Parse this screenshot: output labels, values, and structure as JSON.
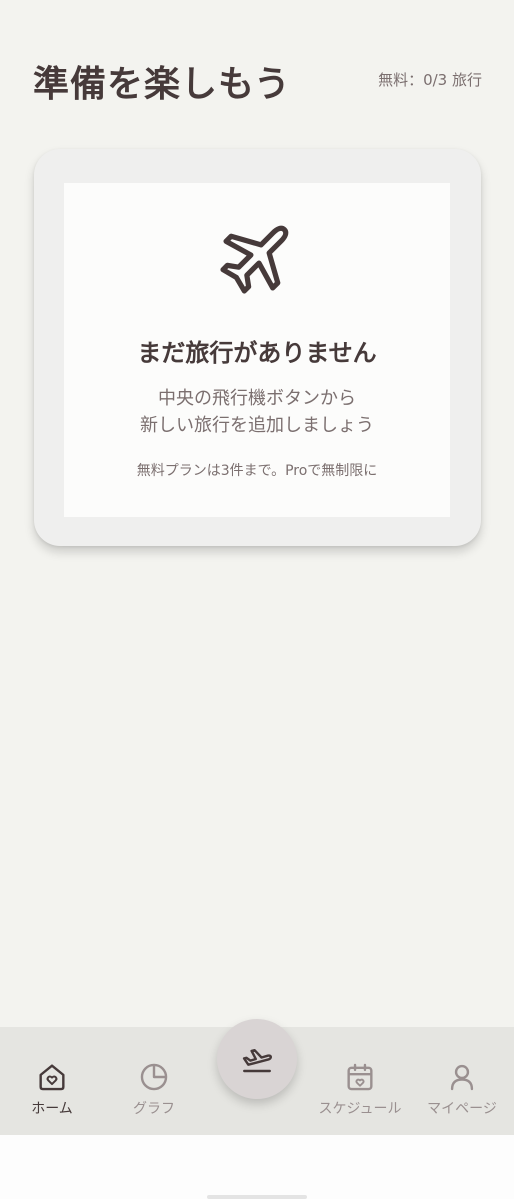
{
  "header": {
    "title": "準備を楽しもう",
    "quota": "無料：0/3 旅行"
  },
  "empty_state": {
    "icon": "airplane-icon",
    "title": "まだ旅行がありません",
    "description_line1": "中央の飛行機ボタンから",
    "description_line2": "新しい旅行を追加しましょう",
    "note": "無料プランは3件まで。Proで無制限に"
  },
  "tabs": [
    {
      "label": "ホーム",
      "icon": "home-heart-icon",
      "active": true
    },
    {
      "label": "グラフ",
      "icon": "pie-chart-icon",
      "active": false
    },
    {
      "label": "スケジュール",
      "icon": "calendar-heart-icon",
      "active": false
    },
    {
      "label": "マイページ",
      "icon": "user-icon",
      "active": false
    }
  ],
  "fab": {
    "icon": "airplane-takeoff-icon"
  },
  "colors": {
    "background": "#f3f3ef",
    "text_primary": "#463a3a",
    "text_secondary": "#7b6f6f",
    "tab_inactive": "#9a9090",
    "fab": "#d9d4d4",
    "tabbar": "#e5e5e1"
  }
}
